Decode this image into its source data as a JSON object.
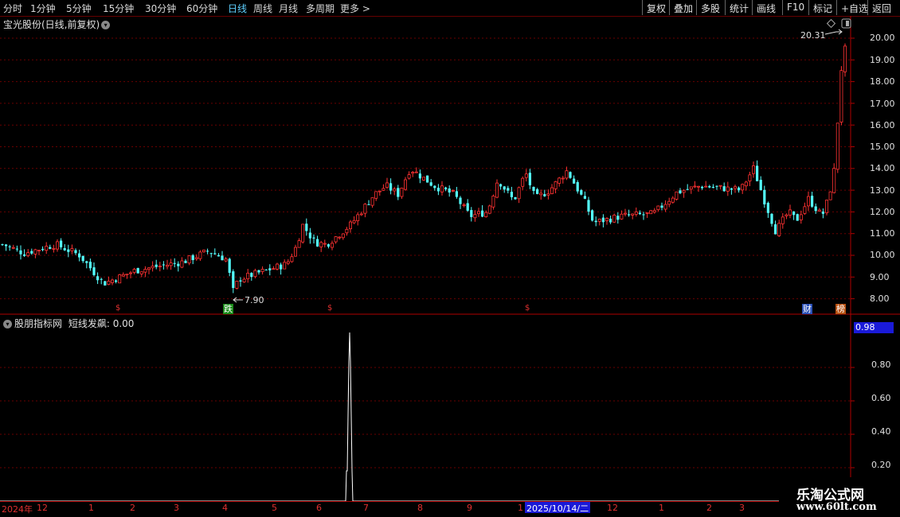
{
  "toolbar": {
    "periods": [
      "分时",
      "1分钟",
      "5分钟",
      "15分钟",
      "30分钟",
      "60分钟",
      "日线",
      "周线",
      "月线",
      "多周期",
      "更多 >"
    ],
    "active_period": "日线",
    "right_buttons": [
      "复权",
      "叠加",
      "多股",
      "统计",
      "画线",
      "F10",
      "标记",
      "+自选",
      "返回"
    ]
  },
  "chart": {
    "title": "宝光股份(日线,前复权)",
    "y_ticks": [
      "20.00",
      "19.00",
      "18.00",
      "17.00",
      "16.00",
      "15.00",
      "14.00",
      "13.00",
      "12.00",
      "11.00",
      "10.00",
      "9.00",
      "8.00"
    ],
    "high_label": "20.31",
    "low_label": "7.90",
    "badges": [
      {
        "text": "跌",
        "color": "#1a8c1a"
      },
      {
        "text": "财",
        "color": "#2a50b8"
      },
      {
        "text": "榜",
        "color": "#b85010"
      }
    ]
  },
  "indicator": {
    "name": "股朋指标网",
    "line_label": "短线发飙: 0.00",
    "current_value": "0.98",
    "y_ticks": [
      "0.80",
      "0.60",
      "0.40",
      "0.20"
    ]
  },
  "x_axis": {
    "labels": [
      "2024年",
      "12",
      "1",
      "2",
      "3",
      "4",
      "5",
      "6",
      "7",
      "8",
      "9",
      "1",
      "12",
      "1",
      "2",
      "3"
    ],
    "highlight": "2025/10/14/二"
  },
  "watermark": {
    "line1": "乐淘公式网",
    "line2": "www.60lt.com"
  },
  "colors": {
    "up": "#ff3232",
    "down": "#54ffff",
    "grid": "#6a0000",
    "indicator": "#ffffff"
  }
}
